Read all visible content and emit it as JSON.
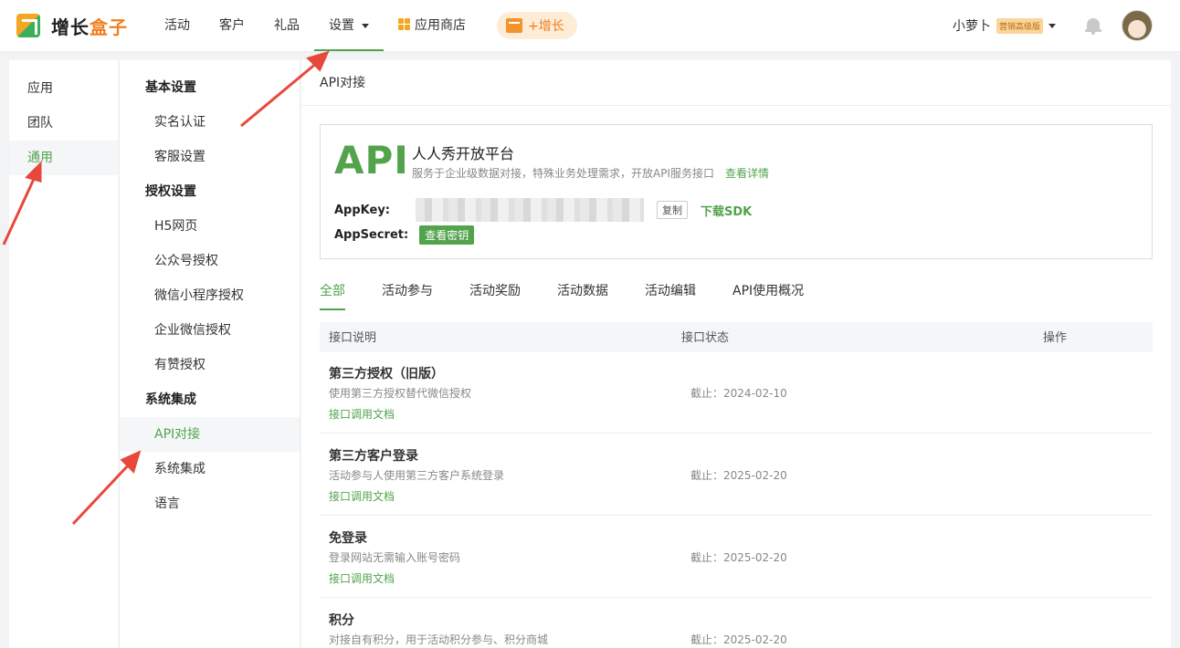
{
  "app": {
    "logo_text_main": "增长",
    "logo_text_accent": "盒子"
  },
  "nav": {
    "items": [
      {
        "label": "活动"
      },
      {
        "label": "客户"
      },
      {
        "label": "礼品"
      },
      {
        "label": "设置"
      }
    ],
    "store_label": "应用商店",
    "grow_label": "+增长"
  },
  "user": {
    "name": "小萝卜",
    "plan": "营销高级版"
  },
  "left_menu": {
    "items": [
      {
        "label": "应用"
      },
      {
        "label": "团队"
      },
      {
        "label": "通用"
      }
    ],
    "active_index": 2
  },
  "mid_menu": {
    "groups": [
      {
        "title": "基本设置",
        "items": [
          "实名认证",
          "客服设置"
        ]
      },
      {
        "title": "授权设置",
        "items": [
          "H5网页",
          "公众号授权",
          "微信小程序授权",
          "企业微信授权",
          "有赞授权"
        ]
      },
      {
        "title": "系统集成",
        "items": [
          "API对接",
          "系统集成",
          "语言"
        ]
      }
    ]
  },
  "main": {
    "title": "API对接",
    "card": {
      "logo": "API",
      "name": "人人秀开放平台",
      "desc": "服务于企业级数据对接，特殊业务处理需求，开放API服务接口",
      "detail_link": "查看详情",
      "appkey_label": "AppKey:",
      "copy_label": "复制",
      "sdk_label": "下载SDK",
      "appsecret_label": "AppSecret:",
      "secret_btn": "查看密钥"
    },
    "tabs": [
      "全部",
      "活动参与",
      "活动奖励",
      "活动数据",
      "活动编辑",
      "API使用概况"
    ],
    "active_tab": 0,
    "table": {
      "headers": [
        "接口说明",
        "接口状态",
        "操作"
      ],
      "rows": [
        {
          "name": "第三方授权（旧版）",
          "desc": "使用第三方授权替代微信授权",
          "doc": "接口调用文档",
          "status": "截止：2024-02-10"
        },
        {
          "name": "第三方客户登录",
          "desc": "活动参与人使用第三方客户系统登录",
          "doc": "接口调用文档",
          "status": "截止：2025-02-20"
        },
        {
          "name": "免登录",
          "desc": "登录网站无需输入账号密码",
          "doc": "接口调用文档",
          "status": "截止：2025-02-20"
        },
        {
          "name": "积分",
          "desc": "对接自有积分，用于活动积分参与、积分商城",
          "doc": "",
          "status": "截止：2025-02-20"
        }
      ]
    }
  },
  "colors": {
    "accent_green": "#52a34c",
    "brand_orange": "#f07f1d",
    "annotation_red": "#e8483b"
  }
}
